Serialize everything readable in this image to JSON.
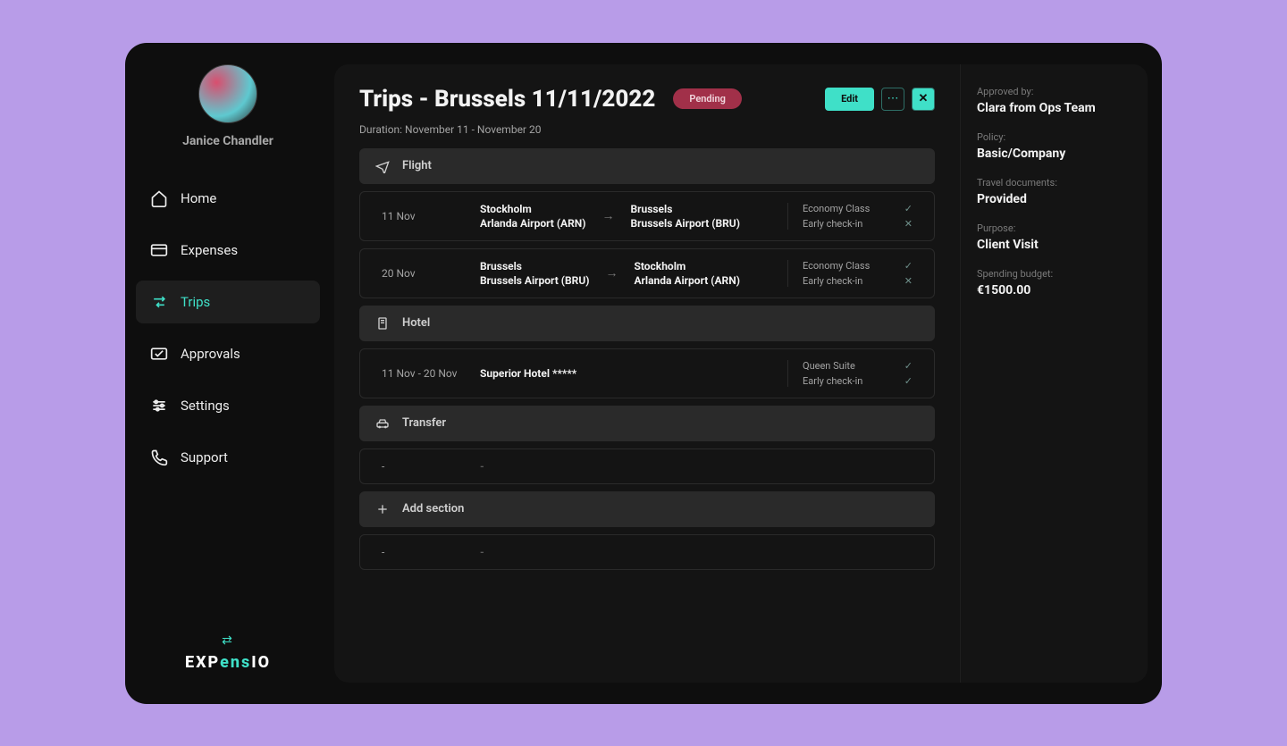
{
  "user": {
    "name": "Janice Chandler"
  },
  "nav": {
    "home": "Home",
    "expenses": "Expenses",
    "trips": "Trips",
    "approvals": "Approvals",
    "settings": "Settings",
    "support": "Support"
  },
  "logo": {
    "part1": "EXP",
    "part2": "ens",
    "part3": "IO"
  },
  "header": {
    "title": "Trips - Brussels 11/11/2022",
    "status": "Pending",
    "edit": "Edit"
  },
  "duration": "Duration: November 11 - November 20",
  "sections": {
    "flight": "Flight",
    "hotel": "Hotel",
    "transfer": "Transfer",
    "add": "Add section"
  },
  "flights": [
    {
      "date": "11 Nov",
      "from_city": "Stockholm",
      "from_air": "Arlanda Airport (ARN)",
      "to_city": "Brussels",
      "to_air": "Brussels Airport (BRU)",
      "class": "Economy Class",
      "class_ok": "✓",
      "checkin": "Early check-in",
      "checkin_ok": "✕"
    },
    {
      "date": "20 Nov",
      "from_city": "Brussels",
      "from_air": "Brussels Airport (BRU)",
      "to_city": "Stockholm",
      "to_air": "Arlanda Airport (ARN)",
      "class": "Economy Class",
      "class_ok": "✓",
      "checkin": "Early check-in",
      "checkin_ok": "✕"
    }
  ],
  "hotel": {
    "dates": "11 Nov - 20 Nov",
    "name": "Superior Hotel *****",
    "suite": "Queen Suite",
    "suite_ok": "✓",
    "checkin": "Early check-in",
    "checkin_ok": "✓"
  },
  "empty": {
    "date": "-",
    "name": "-"
  },
  "info": {
    "approved_label": "Approved by:",
    "approved_value": "Clara from Ops Team",
    "policy_label": "Policy:",
    "policy_value": "Basic/Company",
    "docs_label": "Travel documents:",
    "docs_value": "Provided",
    "purpose_label": "Purpose:",
    "purpose_value": "Client Visit",
    "budget_label": "Spending budget:",
    "budget_value": "€1500.00"
  }
}
